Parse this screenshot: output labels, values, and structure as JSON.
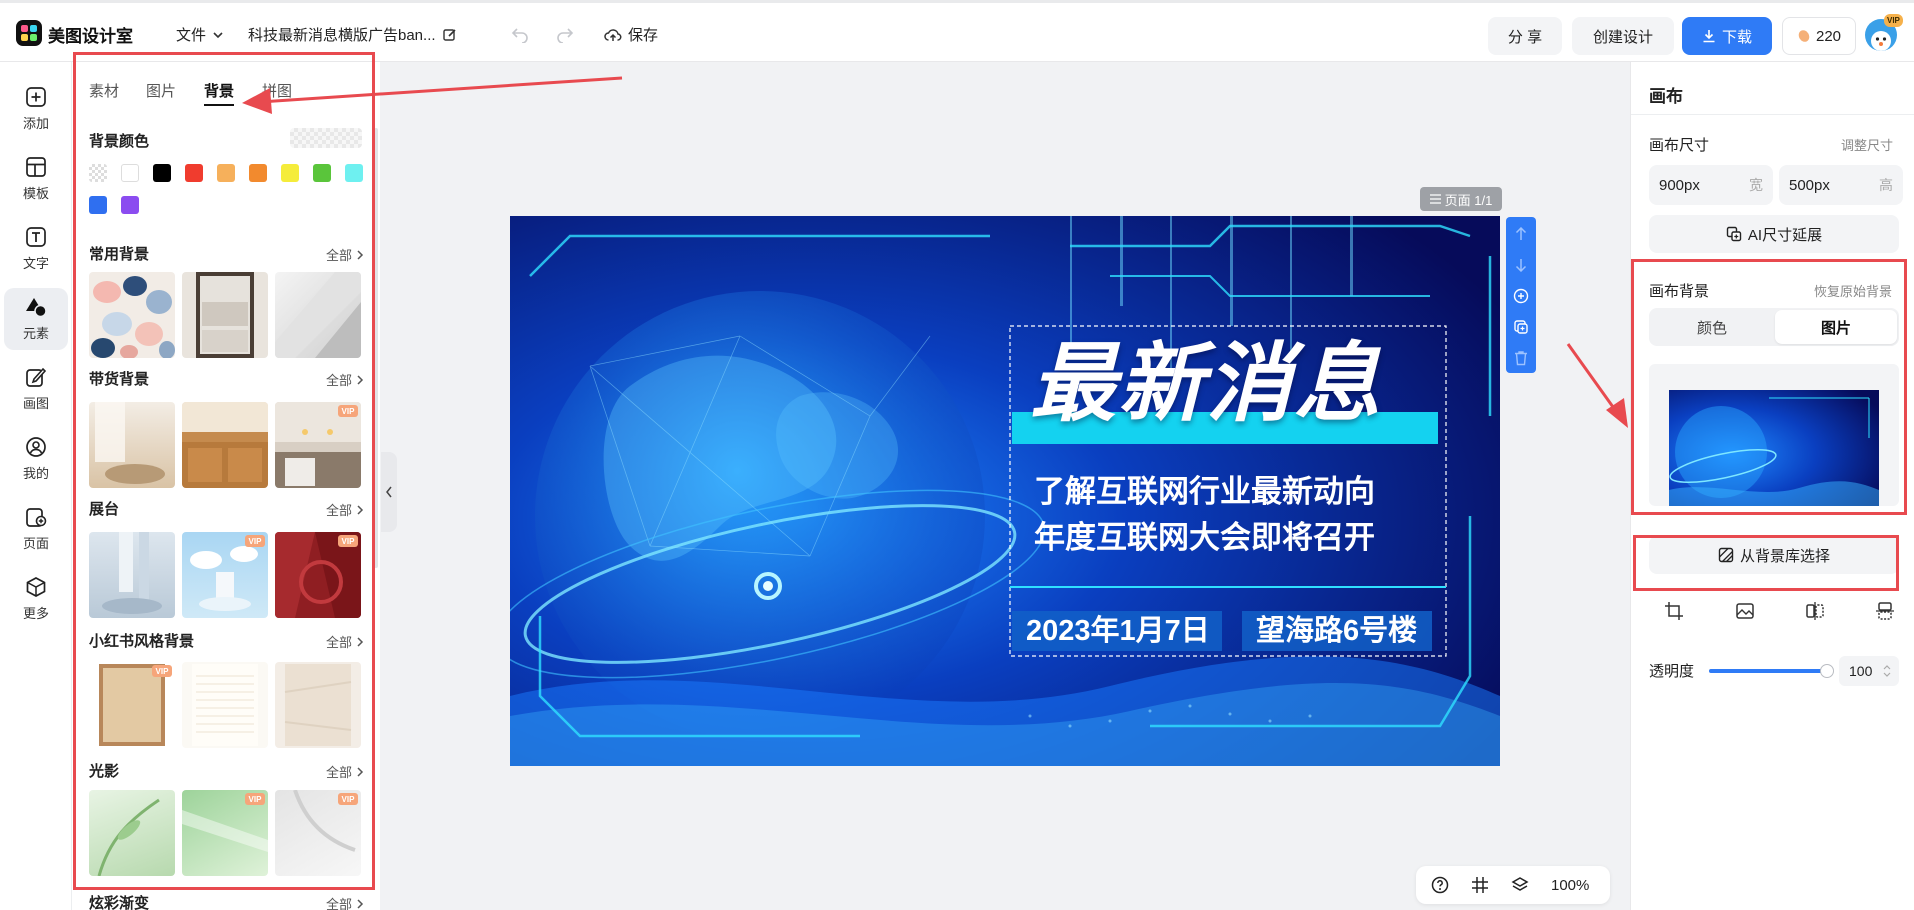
{
  "header": {
    "app_name": "美图设计室",
    "file_menu": "文件",
    "doc_title": "科技最新消息横版广告ban...",
    "save": "保存",
    "share": "分 享",
    "create_design": "创建设计",
    "download": "下载",
    "credits": "220",
    "vip_badge": "VIP"
  },
  "rail": [
    {
      "label": "添加",
      "icon": "plus-square-icon"
    },
    {
      "label": "模板",
      "icon": "layout-template-icon"
    },
    {
      "label": "文字",
      "icon": "text-icon"
    },
    {
      "label": "元素",
      "icon": "shapes-icon"
    },
    {
      "label": "画图",
      "icon": "draw-icon"
    },
    {
      "label": "我的",
      "icon": "user-icon"
    },
    {
      "label": "页面",
      "icon": "page-icon"
    },
    {
      "label": "更多",
      "icon": "more-box-icon"
    }
  ],
  "panel": {
    "tabs": [
      "素材",
      "图片",
      "背景",
      "拼图"
    ],
    "active_tab": "背景",
    "bg_color_title": "背景颜色",
    "swatches": [
      "transparent",
      "#ffffff",
      "#000000",
      "#f03c2e",
      "#f6b05b",
      "#f28a2e",
      "#f5ec3b",
      "#5ac53b",
      "#6ef0f0",
      "#2f6ff0",
      "#8b4cf0"
    ],
    "all_label": "全部",
    "sections": [
      "常用背景",
      "带货背景",
      "展台",
      "小红书风格背景",
      "光影",
      "炫彩渐变"
    ],
    "vip": "VIP"
  },
  "canvas": {
    "page_label": "页面 1/1",
    "headline": "最新消息",
    "line1": "了解互联网行业最新动向",
    "line2": "年度互联网大会即将召开",
    "date": "2023年1月7日",
    "location": "望海路6号楼"
  },
  "right": {
    "title": "画布",
    "size_title": "画布尺寸",
    "adjust_size": "调整尺寸",
    "width_value": "900px",
    "width_unit": "宽",
    "height_value": "500px",
    "height_unit": "高",
    "ai_extend": "AI尺寸延展",
    "bg_title": "画布背景",
    "restore_bg": "恢复原始背景",
    "tab_color": "颜色",
    "tab_image": "图片",
    "pick_from_library": "从背景库选择",
    "opacity_label": "透明度",
    "opacity_value": "100",
    "opacity_fraction": 1.0
  },
  "bottom": {
    "zoom": "100%"
  },
  "colors": {
    "accent": "#2f7bf6",
    "highlight": "#e84a4f"
  }
}
